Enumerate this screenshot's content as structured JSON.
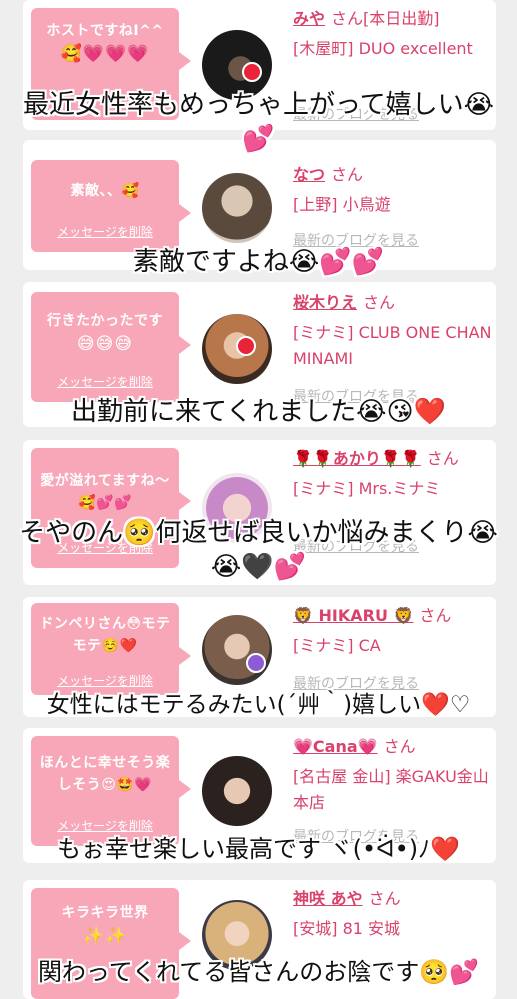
{
  "cards": [
    {
      "message": "ホストですねI^^",
      "emoji": "🥰💗💗💗",
      "delete_label": "",
      "name": "みや",
      "suffix": "さん[本日出勤]",
      "shop": "[木屋町] DUO excellent",
      "blog": "最新のブログを見る"
    },
    {
      "message": "素敵、、🥰",
      "emoji": "",
      "delete_label": "メッセージを削除",
      "name": "なつ",
      "suffix": "さん",
      "shop": "[上野] 小鳥遊",
      "blog": "最新のブログを見る"
    },
    {
      "message": "行きたかったです",
      "emoji": "😅😅😅",
      "delete_label": "メッセージを削除",
      "name": "桜木りえ",
      "suffix": "さん",
      "shop": "[ミナミ] CLUB ONE CHAN MINAMI",
      "blog": "最新のブログを見る"
    },
    {
      "message": "愛が溢れてますね〜🥰💕💕",
      "emoji": "",
      "delete_label": "メッセージを削除",
      "name": "🌹🌹あかり🌹🌹",
      "suffix": "さん",
      "shop": "[ミナミ] Mrs.ミナミ",
      "blog": "最新のブログを見る"
    },
    {
      "message": "ドンペリさん😳モテモテ☺️❤️",
      "emoji": "",
      "delete_label": "メッセージを削除",
      "name": "🦁 HIKARU 🦁",
      "suffix": "さん",
      "shop": "[ミナミ] CA",
      "blog": "最新のブログを見る"
    },
    {
      "message": "ほんとに幸せそう楽しそう😍🤩💗",
      "emoji": "",
      "delete_label": "メッセージを削除",
      "name": "💗Cana💗",
      "suffix": "さん",
      "shop": "[名古屋 金山] 楽GAKU金山本店",
      "blog": "最新のブログを見る"
    },
    {
      "message": "キラキラ世界",
      "emoji": "✨✨",
      "delete_label": "",
      "name": "神咲 あや",
      "suffix": "さん",
      "shop": "[安城] 81 安城",
      "blog": ""
    }
  ],
  "captions": [
    "最近女性率もめっちゃ上がって嬉しい😭💕",
    "素敵ですよね😭💕💕",
    "出勤前に来てくれました😭😘❤️",
    "そやのん🥺何返せば良いか悩みまくり😭😭🖤💕",
    "女性にはモテるみたい(´艸｀)嬉しい❤️♡",
    "もぉ幸せ楽しい最高です ヾ(•ᐛ•)ﾉ❤️",
    "関わってくれてる皆さんのお陰です🥺💕"
  ],
  "colors": {
    "bubble": "#f8a7b8",
    "name": "#d9426b",
    "background": "#eeeeee"
  }
}
